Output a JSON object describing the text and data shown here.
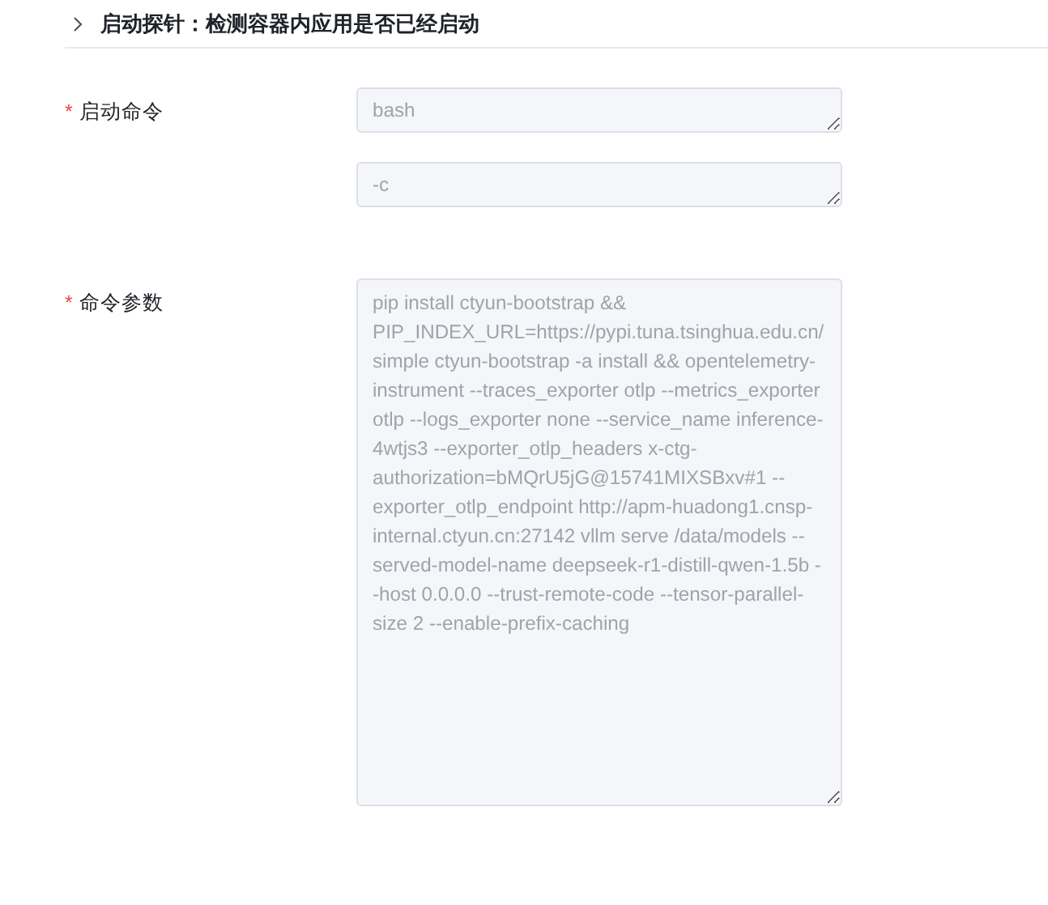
{
  "section": {
    "title": "启动探针：检测容器内应用是否已经启动",
    "expanded": false
  },
  "form_items": [
    {
      "label": "启动命令",
      "required_mark": "*",
      "fields": [
        {
          "value": "bash",
          "disabled": true
        },
        {
          "value": "-c",
          "disabled": true
        }
      ]
    },
    {
      "label": "命令参数",
      "required_mark": "*",
      "fields": [
        {
          "value": "pip install ctyun-bootstrap && PIP_INDEX_URL=https://pypi.tuna.tsinghua.edu.cn/simple ctyun-bootstrap -a install && opentelemetry-instrument --traces_exporter otlp --metrics_exporter otlp --logs_exporter none --service_name inference-4wtjs3 --exporter_otlp_headers x-ctg-authorization=bMQrU5jG@15741MIXSBxv#1 --exporter_otlp_endpoint http://apm-huadong1.cnsp-internal.ctyun.cn:27142 vllm serve /data/models --served-model-name deepseek-r1-distill-qwen-1.5b --host 0.0.0.0 --trust-remote-code --tensor-parallel-size 2 --enable-prefix-caching",
          "disabled": true
        }
      ]
    }
  ]
}
